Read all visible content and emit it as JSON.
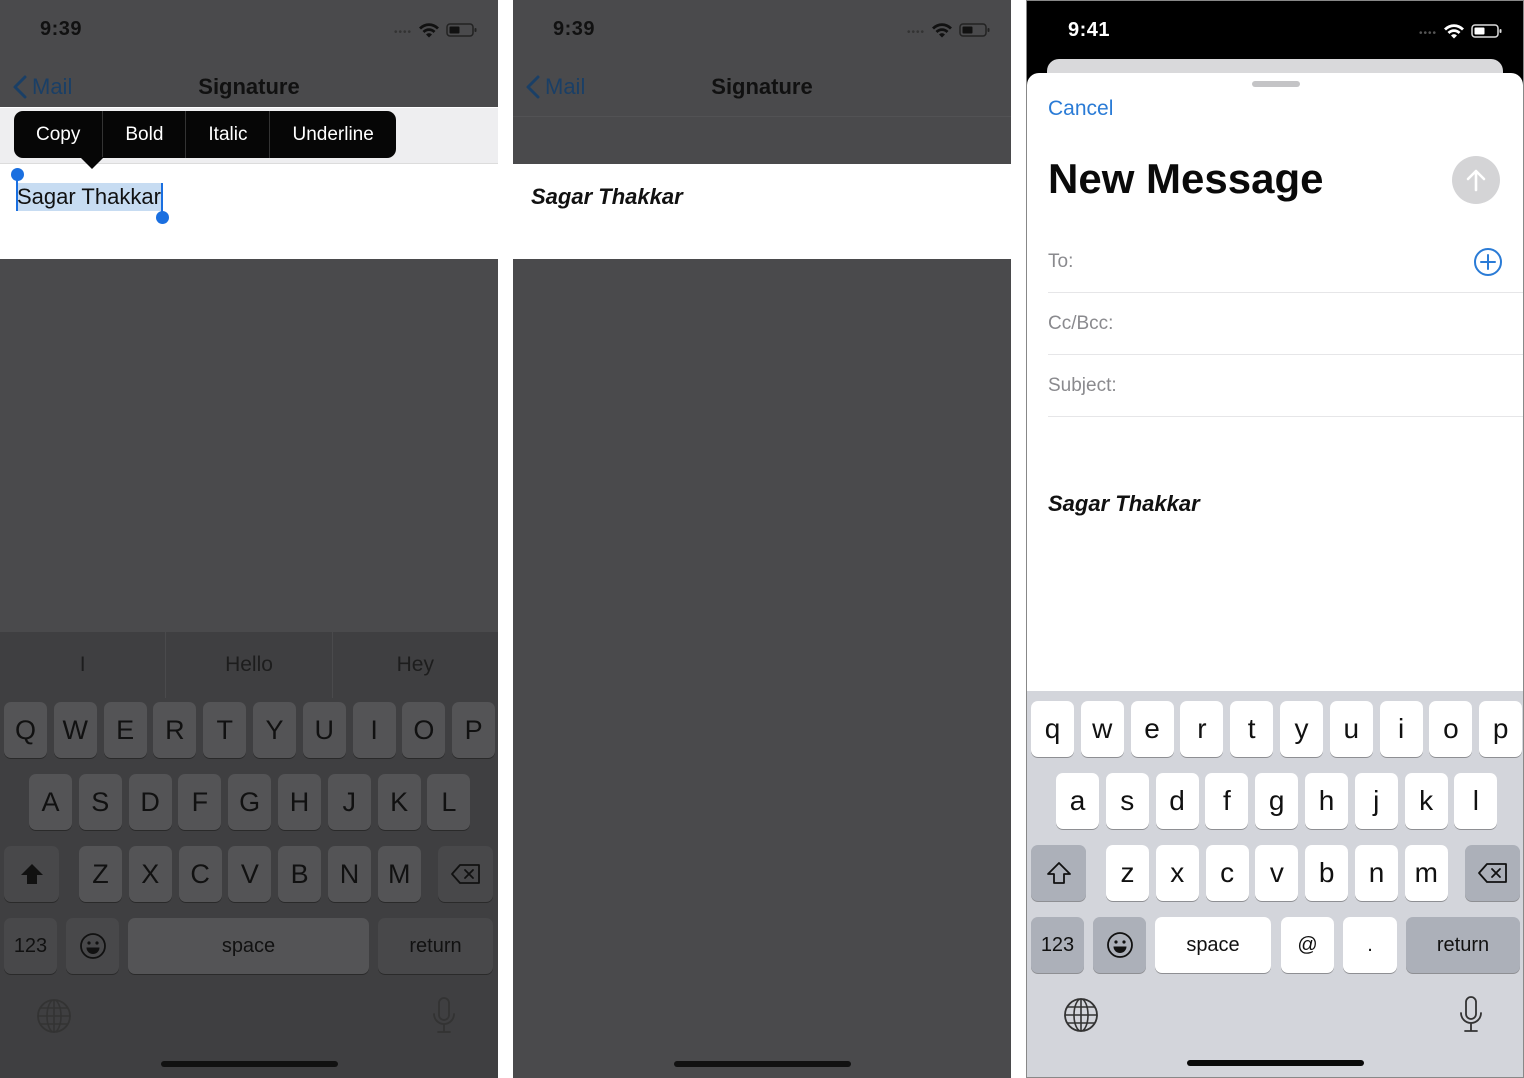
{
  "panel1": {
    "status": {
      "time": "9:39",
      "signal": "signal-dots",
      "wifi": "wifi-icon",
      "battery": "battery-icon"
    },
    "nav": {
      "back_label": "Mail",
      "title": "Signature"
    },
    "context_menu": [
      "Copy",
      "Bold",
      "Italic",
      "Underline"
    ],
    "selected_text": "Sagar Thakkar",
    "predictions": [
      "I",
      "Hello",
      "Hey"
    ],
    "keyboard": {
      "row1": [
        "Q",
        "W",
        "E",
        "R",
        "T",
        "Y",
        "U",
        "I",
        "O",
        "P"
      ],
      "row2": [
        "A",
        "S",
        "D",
        "F",
        "G",
        "H",
        "J",
        "K",
        "L"
      ],
      "row3": [
        "Z",
        "X",
        "C",
        "V",
        "B",
        "N",
        "M"
      ],
      "numbers_label": "123",
      "space_label": "space",
      "return_label": "return"
    }
  },
  "panel2": {
    "status": {
      "time": "9:39"
    },
    "nav": {
      "back_label": "Mail",
      "title": "Signature"
    },
    "signature_text": "Sagar Thakkar"
  },
  "panel3": {
    "status": {
      "time": "9:41"
    },
    "cancel_label": "Cancel",
    "title": "New Message",
    "fields": {
      "to_label": "To:",
      "to_value": "",
      "cc_label": "Cc/Bcc:",
      "cc_value": "",
      "subject_label": "Subject:",
      "subject_value": ""
    },
    "signature_text": "Sagar Thakkar",
    "keyboard": {
      "row1": [
        "q",
        "w",
        "e",
        "r",
        "t",
        "y",
        "u",
        "i",
        "o",
        "p"
      ],
      "row2": [
        "a",
        "s",
        "d",
        "f",
        "g",
        "h",
        "j",
        "k",
        "l"
      ],
      "row3": [
        "z",
        "x",
        "c",
        "v",
        "b",
        "n",
        "m"
      ],
      "numbers_label": "123",
      "space_label": "space",
      "at_label": "@",
      "dot_label": ".",
      "return_label": "return"
    }
  },
  "colors": {
    "accent_blue": "#2a7bd6",
    "selection_handle": "#1a6fe0",
    "selection_fill": "#c7dcf2",
    "dim_overlay": "#4a4a4c",
    "keyboard_light": "#d3d5db"
  }
}
